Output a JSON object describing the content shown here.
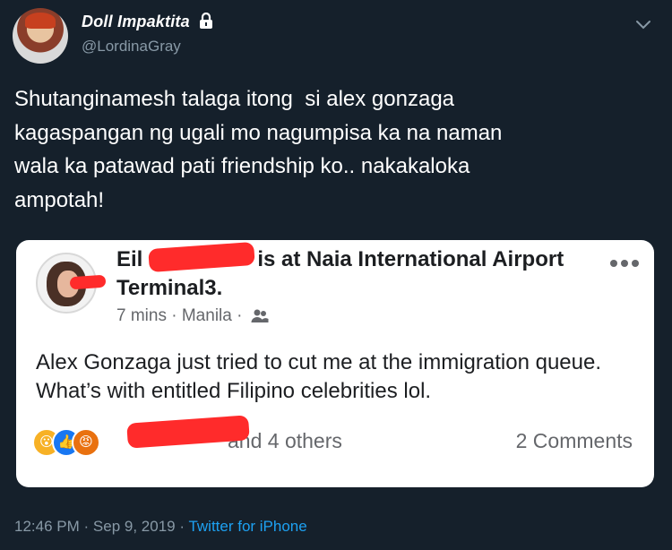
{
  "author": {
    "display_name": "Doll Impaktita",
    "handle": "@LordinaGray"
  },
  "icons": {
    "lock": "lock-icon",
    "chevron": "chevron-down-icon",
    "more": "more-options-icon",
    "audience": "friends-icon"
  },
  "tweet": {
    "text": "Shutanginamesh talaga itong  si alex gonzaga\nkagaspangan ng ugali mo nagumpisa ka na naman\nwala ka patawad pati friendship ko.. nakakaloka\nampotah!"
  },
  "embedded_post": {
    "name_partial_start": "Eil",
    "header_rest": "is at Naia International Airport Terminal3.",
    "time": "7 mins",
    "dot": "·",
    "location": "Manila",
    "body": "Alex Gonzaga just tried to cut me at the immigration queue. What’s with entitled Filipino celebrities lol.",
    "reactions_suffix": "and 4 others",
    "comments": "2 Comments"
  },
  "footer": {
    "time": "12:46 PM",
    "date": "Sep 9, 2019",
    "separator": "·",
    "source": "Twitter for iPhone"
  },
  "colors": {
    "background": "#15202b",
    "secondary_text": "#8899a6",
    "link": "#1da1f2",
    "redaction": "#ff2b2b"
  }
}
